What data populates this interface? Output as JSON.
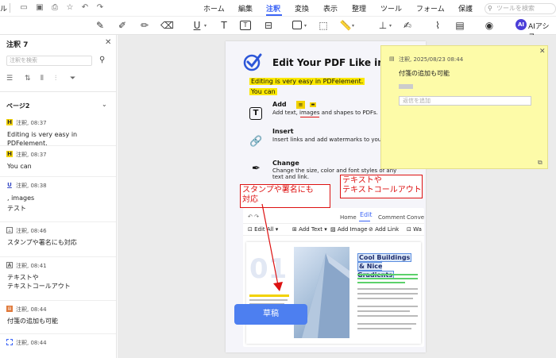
{
  "topbar": {
    "cut_label": "ル",
    "menus": [
      "ホーム",
      "編集",
      "注釈",
      "変換",
      "表示",
      "整理",
      "ツール",
      "フォーム",
      "保護"
    ],
    "active_menu": "注釈",
    "search_placeholder": "ツールを検索"
  },
  "toolbar": {
    "ai_badge": "AI",
    "ai_label": "AIアシス"
  },
  "sidebar": {
    "title": "注釈 7",
    "search_placeholder": "注釈を検索",
    "page_label": "ページ2",
    "notes": [
      {
        "icon": "H",
        "meta": "注釈, 08:37",
        "text": "Editing is very easy in PDFelement.",
        "type": "highlight"
      },
      {
        "icon": "H",
        "meta": "注釈, 08:37",
        "text": "You can",
        "type": "highlight"
      },
      {
        "icon": "U",
        "meta": "注釈, 08:38",
        "text": ", images\nテスト",
        "type": "underline"
      },
      {
        "icon": "stamp",
        "meta": "注釈, 08:46",
        "text": "スタンプや署名にも対応",
        "type": "stamp"
      },
      {
        "icon": "A",
        "meta": "注釈, 08:41",
        "text": "テキストや\nテキストコールアウト",
        "type": "callout"
      },
      {
        "icon": "note",
        "meta": "注釈, 08:44",
        "text": "付箋の追加も可能",
        "type": "note"
      },
      {
        "icon": "area",
        "meta": "注釈, 08:44",
        "text": "",
        "type": "area"
      }
    ]
  },
  "pdf": {
    "title": "Edit Your PDF Like in W",
    "highlight1": "Editing is very easy in PDFelement.",
    "highlight2": "You can",
    "features": [
      {
        "title": "Add",
        "desc": "Add text, images and shapes to PDFs."
      },
      {
        "title": "Insert",
        "desc": "Insert links and add watermarks to your P"
      },
      {
        "title": "Change",
        "desc_line1": "Change the size, color and font styles of any",
        "desc_line2": "text and link."
      }
    ],
    "callout1": "テキストや\nテキストコールアウト",
    "callout2": "スタンプや署名にも\n対応",
    "editor_tabs": [
      "Home",
      "Edit",
      "Comment",
      "Convert"
    ],
    "editor_tools": [
      "Edit All",
      "Add Text",
      "Add Image",
      "Add Link",
      "Wa"
    ],
    "card_title_1": "Cool Buildings",
    "card_title_2": "& Nice Gradients",
    "card_number": "01"
  },
  "draft_stamp": "草稿",
  "sticky": {
    "meta": "注釈,  2025/08/23 08:44",
    "text": "付箋の追加も可能",
    "reply_placeholder": "返信を追加"
  }
}
